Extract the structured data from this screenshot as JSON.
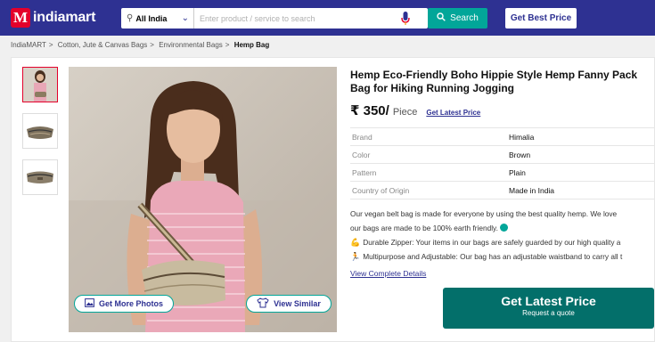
{
  "header": {
    "logo_letter": "M",
    "logo_text": "indiamart",
    "location": "All India",
    "search_placeholder": "Enter product / service to search",
    "search_label": "Search",
    "best_price_label": "Get Best Price"
  },
  "breadcrumb": {
    "items": [
      "IndiaMART",
      "Cotton, Jute & Canvas Bags",
      "Environmental Bags"
    ],
    "current": "Hemp Bag",
    "separator": ">"
  },
  "gallery": {
    "more_photos_label": "Get More Photos",
    "view_similar_label": "View Similar"
  },
  "product": {
    "title_line1": "Hemp Eco-Friendly Boho Hippie Style Hemp Fanny Pack",
    "title_line2": "Bag for Hiking Running Jogging",
    "price": "₹ 350/",
    "unit": "Piece",
    "latest_price_link": "Get Latest Price",
    "specs": [
      {
        "key": "Brand",
        "value": "Himalia"
      },
      {
        "key": "Color",
        "value": "Brown"
      },
      {
        "key": "Pattern",
        "value": "Plain"
      },
      {
        "key": "Country of Origin",
        "value": "Made in India"
      }
    ],
    "desc_line1": "Our vegan belt bag is made for everyone by using the best quality hemp. We love",
    "desc_line2": "our bags are made to be 100% earth friendly.",
    "bullet1": "Durable Zipper: Your items in our bags are safely guarded by our high quality a",
    "bullet2": "Multipurpose and Adjustable: Our bag has an adjustable waistband to carry all t",
    "view_details": "View Complete Details"
  },
  "cta": {
    "label": "Get Latest Price",
    "sublabel": "Request a quote"
  },
  "colors": {
    "header_bg": "#2e3192",
    "accent_teal": "#02a699",
    "cta_bg": "#036f6a",
    "logo_red": "#e4002b"
  }
}
